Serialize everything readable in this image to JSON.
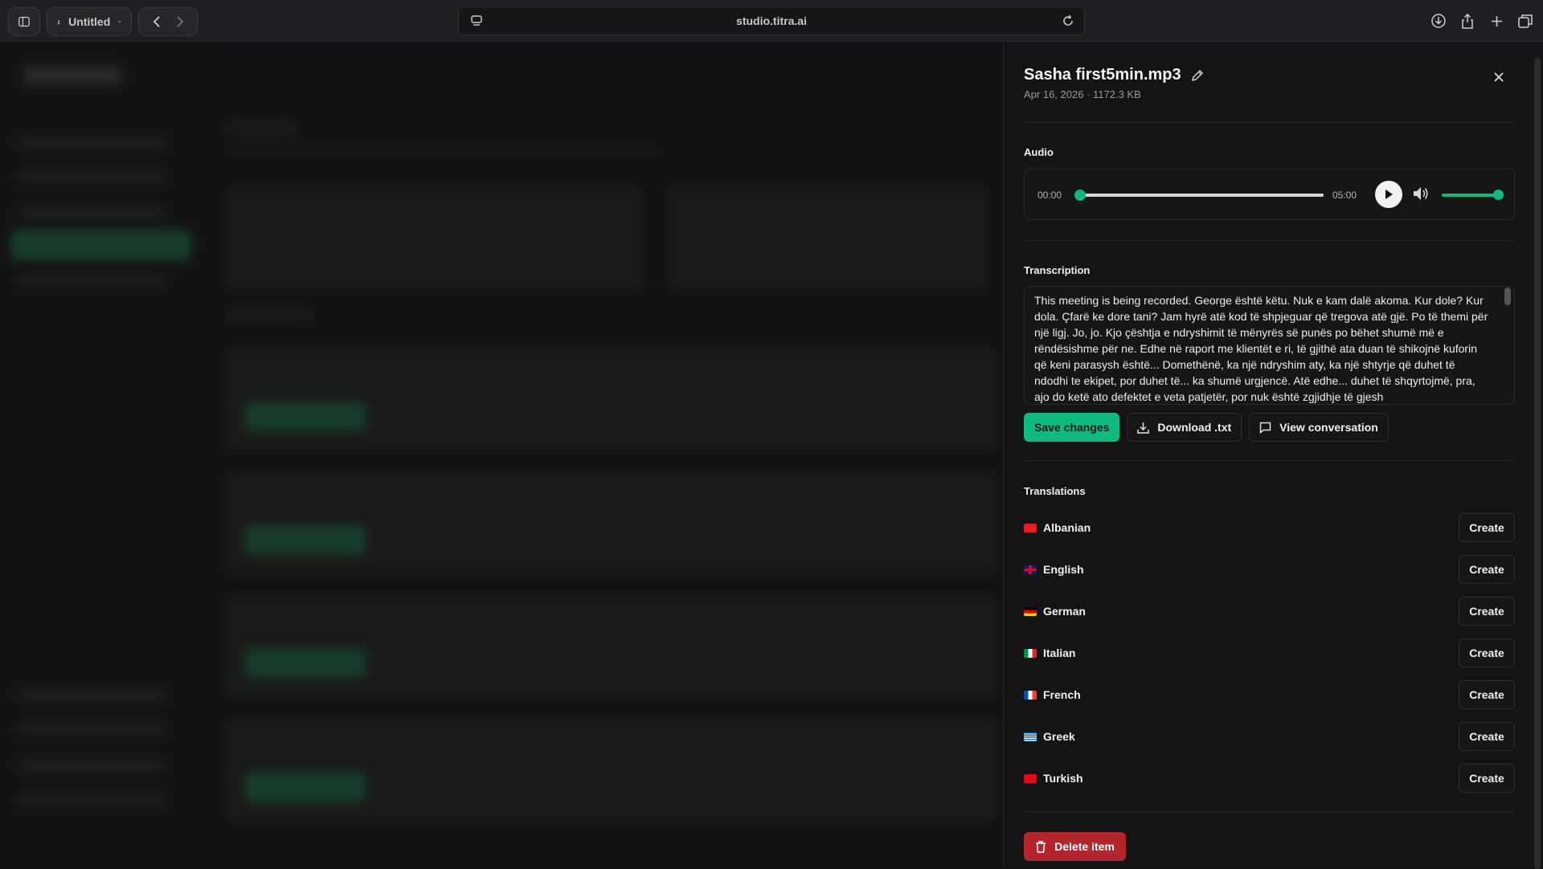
{
  "browser": {
    "profile_label": "Untitled",
    "url": "studio.titra.ai"
  },
  "panel": {
    "title": "Sasha first5min.mp3",
    "date": "Apr 16, 2026",
    "size": "· 1172.3 KB",
    "audio": {
      "label": "Audio",
      "current_time": "00:00",
      "duration": "05:00",
      "progress": 0.0,
      "volume": 1.0
    },
    "transcription": {
      "label": "Transcription",
      "text": "This meeting is being recorded. George është këtu. Nuk e kam dalë akoma. Kur dole? Kur dola. Çfarë ke dore tani? Jam hyrë atë kod të shpjeguar që tregova atë gjë. Po të themi për një ligj. Jo, jo. Kjo çështja e ndryshimit të mënyrës së punës po bëhet shumë më e rëndësishme për ne. Edhe në raport me klientët e ri, të gjithë ata duan të shikojnë kuforin që keni parasysh është... Domethënë, ka një ndryshim aty, ka një shtyrje që duhet të ndodhi te ekipet, por duhet të... ka shumë urgjencë. Atë edhe... duhet të shqyrtojmë, pra, ajo do ketë ato defektet e veta patjetër, por nuk është zgjidhje të gjesh"
    },
    "actions": {
      "save": "Save changes",
      "download": "Download .txt",
      "view": "View conversation"
    },
    "translations": {
      "label": "Translations",
      "create_label": "Create",
      "languages": [
        "Albanian",
        "English",
        "German",
        "Italian",
        "French",
        "Greek",
        "Turkish"
      ]
    },
    "delete_label": "Delete item"
  },
  "colors": {
    "accent": "#10b981",
    "danger": "#b3262d"
  }
}
